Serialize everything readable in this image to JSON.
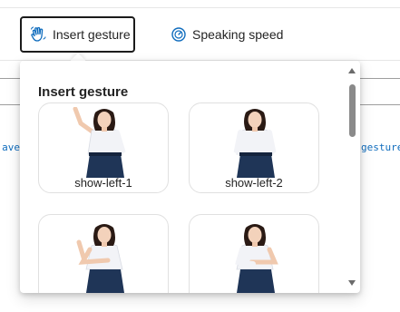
{
  "toolbar": {
    "insert_gesture_label": "Insert gesture",
    "speaking_speed_label": "Speaking speed"
  },
  "background_text": {
    "left_fragment": "ave",
    "right_fragment": "gesture"
  },
  "popup": {
    "title": "Insert gesture",
    "gestures": [
      {
        "label": "show-left-1",
        "pose": "raise-left"
      },
      {
        "label": "show-left-2",
        "pose": "neutral"
      },
      {
        "label": "",
        "pose": "cross"
      },
      {
        "label": "",
        "pose": "cross-right"
      }
    ]
  },
  "colors": {
    "accent": "#0f6cbd",
    "border": "#1b1b1b",
    "text": "#242424",
    "skirt": "#1f3557"
  },
  "icons": {
    "insert_gesture": "hand-wave-icon",
    "speaking_speed": "gauge-icon"
  }
}
